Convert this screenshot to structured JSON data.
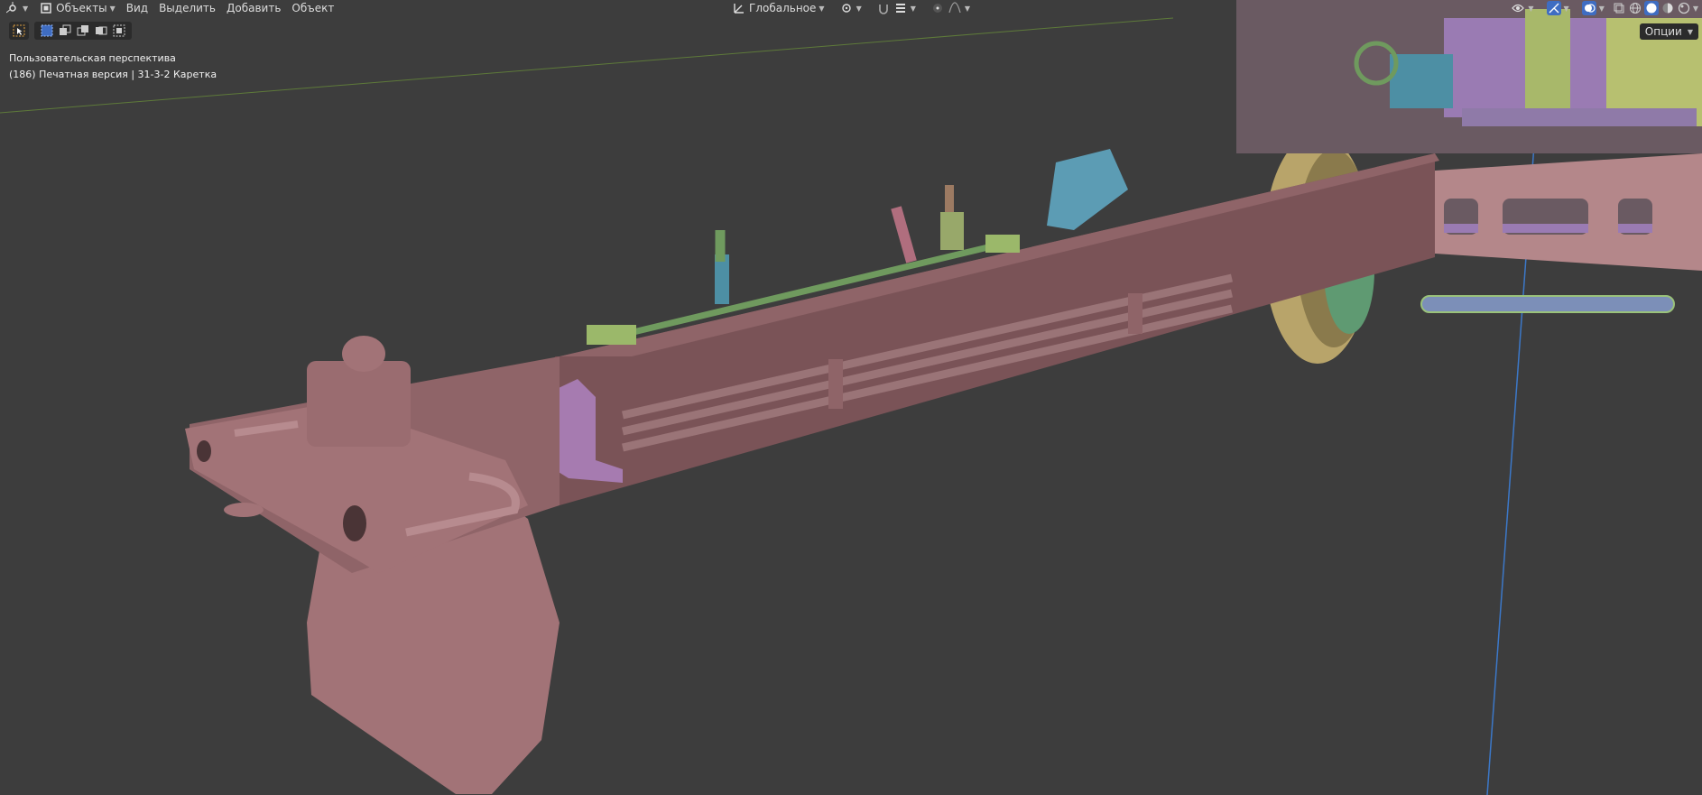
{
  "header": {
    "mode_label": "Объекты",
    "menus": [
      "Вид",
      "Выделить",
      "Добавить",
      "Объект"
    ],
    "orientation_label": "Глобальное"
  },
  "overlay": {
    "view_name": "Пользовательская перспектива",
    "collection_info": "(186) Печатная версия | 31-3-2 Каретка"
  },
  "options_label": "Опции",
  "colors": {
    "background": "#3d3d3d",
    "carriage": "#8f5f64",
    "accent_green": "#6f9a5e",
    "accent_blue": "#4d8fa4",
    "accent_purple": "#9a7bb3",
    "active_button": "#3f6dc2"
  },
  "icons": [
    "editor-type-icon",
    "object-mode-icon",
    "transform-orientation-icon",
    "pivot-icon",
    "snap-icon",
    "proportional-edit-icon",
    "visibility-icon",
    "gizmo-icon",
    "overlay-icon",
    "xray-icon",
    "wireframe-shading-icon",
    "solid-shading-icon",
    "material-shading-icon",
    "rendered-shading-icon",
    "select-tool-icon",
    "select-box-mode-icon"
  ]
}
